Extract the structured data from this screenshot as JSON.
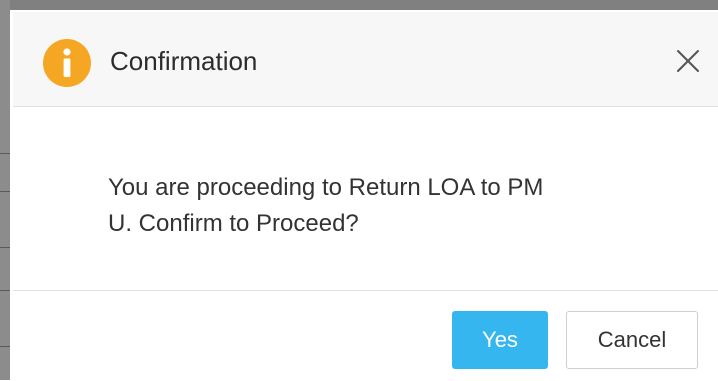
{
  "dialog": {
    "title": "Confirmation",
    "icon": "info-icon",
    "icon_color": "#f5a623",
    "message_lines": [
      "You are proceeding to Return LOA to PM",
      "U. Confirm to Proceed?"
    ],
    "buttons": {
      "yes_label": "Yes",
      "cancel_label": "Cancel"
    },
    "colors": {
      "primary_button": "#35b6ee",
      "header_background": "#f7f7f7"
    }
  }
}
